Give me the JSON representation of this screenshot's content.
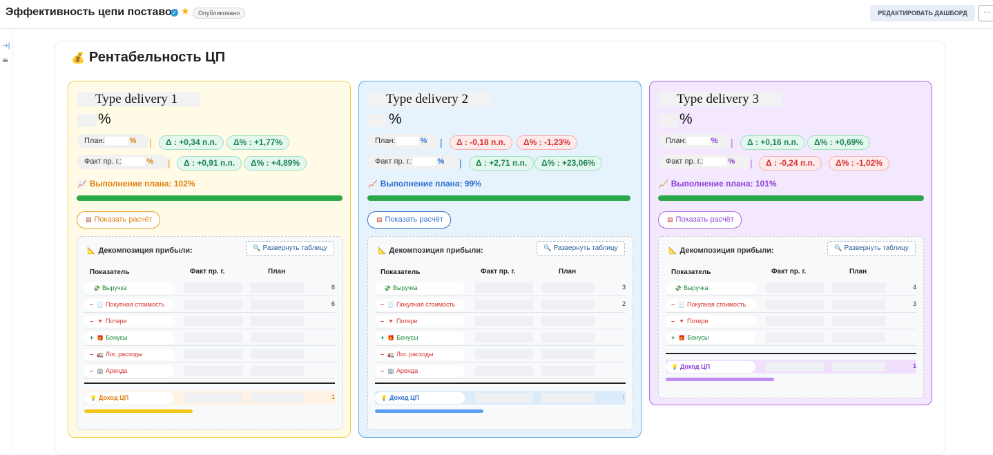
{
  "header": {
    "title": "Эффективность цепи поставок",
    "status_badge": "Опубликовано",
    "edit_button": "РЕДАКТИРОВАТЬ ДАШБОРД",
    "more_button": "···"
  },
  "sidebar": {
    "expand_icon": "→|",
    "filter_icon": "≡"
  },
  "section": {
    "emoji": "💰",
    "title": "Рентабельность ЦП"
  },
  "cards": [
    {
      "name": "Type delivery 1",
      "pct": "%",
      "plan_label": "План:",
      "plan_value": "%",
      "plan_delta": "Δ : +0,34 п.п.",
      "plan_delta_pct": "Δ% : +1,77%",
      "fact_label": "Факт пр. г.:",
      "fact_value": "%",
      "fact_delta": "Δ : +0,91 п.п.",
      "fact_delta_pct": "Δ% : +4,89%",
      "execution": "Выполнение плана: 102%",
      "execution_value": 102,
      "calc_button": "Показать расчёт",
      "accent": "#e07e0f",
      "rows": [
        {
          "sign": "",
          "icon": "💸",
          "label": "Выручка",
          "tail": "8",
          "tone": "green"
        },
        {
          "sign": "–",
          "icon": "🧾",
          "label": "Покупная стоимость",
          "tail": "6",
          "tone": "red"
        },
        {
          "sign": "–",
          "icon": "🔻",
          "label": "Потери",
          "tail": "",
          "tone": "red"
        },
        {
          "sign": "+",
          "icon": "🎁",
          "label": "Бонусы",
          "tail": "",
          "tone": "green"
        },
        {
          "sign": "–",
          "icon": "🚛",
          "label": "Лог. расходы",
          "tail": "",
          "tone": "red"
        },
        {
          "sign": "–",
          "icon": "🏢",
          "label": "Аренда",
          "tail": "",
          "tone": "red"
        }
      ],
      "total": {
        "icon": "💡",
        "label": "Доход ЦП",
        "tail": "1"
      }
    },
    {
      "name": "Type delivery 2",
      "pct": "%",
      "plan_label": "План:",
      "plan_value": "%",
      "plan_delta": "Δ : -0,18 п.п.",
      "plan_delta_pct": "Δ% : -1,23%",
      "fact_label": "Факт пр. г.:",
      "fact_value": "%",
      "fact_delta": "Δ : +2,71 п.п.",
      "fact_delta_pct": "Δ% : +23,06%",
      "execution": "Выполнение плана: 99%",
      "execution_value": 99,
      "calc_button": "Показать расчёт",
      "accent": "#2f6fd0",
      "rows": [
        {
          "sign": "",
          "icon": "💸",
          "label": "Выручка",
          "tail": "3",
          "tone": "green"
        },
        {
          "sign": "–",
          "icon": "🧾",
          "label": "Покупная стоимость",
          "tail": "2",
          "tone": "red"
        },
        {
          "sign": "–",
          "icon": "🔻",
          "label": "Потери",
          "tail": "",
          "tone": "red"
        },
        {
          "sign": "+",
          "icon": "🎁",
          "label": "Бонусы",
          "tail": "",
          "tone": "green"
        },
        {
          "sign": "–",
          "icon": "🚛",
          "label": "Лог. расходы",
          "tail": "",
          "tone": "red"
        },
        {
          "sign": "–",
          "icon": "🏢",
          "label": "Аренда",
          "tail": "",
          "tone": "red"
        }
      ],
      "total": {
        "icon": "💡",
        "label": "Доход ЦП",
        "tail": ":"
      }
    },
    {
      "name": "Type delivery 3",
      "pct": "%",
      "plan_label": "План:",
      "plan_value": "%",
      "plan_delta": "Δ : +0,16 п.п.",
      "plan_delta_pct": "Δ% : +0,69%",
      "fact_label": "Факт пр. г.:",
      "fact_value": "%",
      "fact_delta": "Δ : -0,24 п.п.",
      "fact_delta_pct": "Δ% : -1,02%",
      "execution": "Выполнение плана: 101%",
      "execution_value": 101,
      "calc_button": "Показать расчёт",
      "accent": "#8b3fd8",
      "rows": [
        {
          "sign": "",
          "icon": "💸",
          "label": "Выручка",
          "tail": "4",
          "tone": "green"
        },
        {
          "sign": "–",
          "icon": "🧾",
          "label": "Покупная стоимость",
          "tail": "3",
          "tone": "red"
        },
        {
          "sign": "–",
          "icon": "🔻",
          "label": "Потери",
          "tail": "",
          "tone": "red"
        },
        {
          "sign": "+",
          "icon": "🎁",
          "label": "Бонусы",
          "tail": "",
          "tone": "green"
        }
      ],
      "total": {
        "icon": "💡",
        "label": "Доход ЦП",
        "tail": "1"
      }
    }
  ],
  "decomposition": {
    "title": "Декомпозиция прибыли:",
    "expand_button": "Развернуть таблицу",
    "col_indicator": "Показатель",
    "col_fact": "Факт пр. г.",
    "col_plan": "План"
  }
}
